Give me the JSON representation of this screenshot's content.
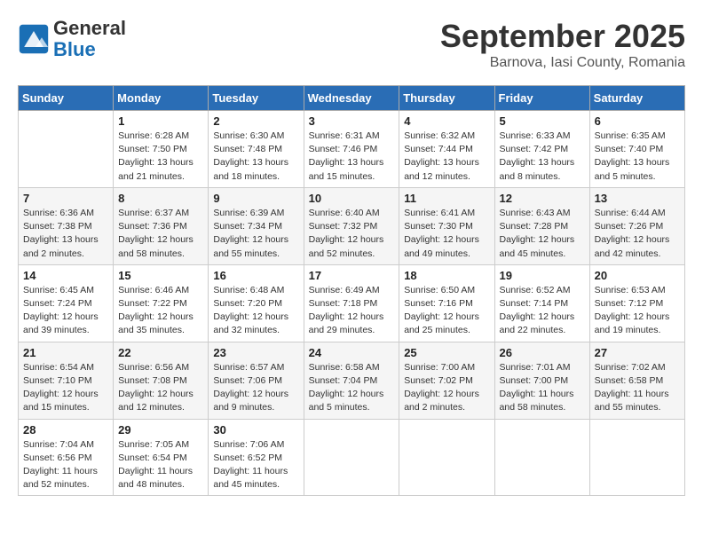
{
  "header": {
    "logo_line1": "General",
    "logo_line2": "Blue",
    "month_title": "September 2025",
    "location": "Barnova, Iasi County, Romania"
  },
  "days_of_week": [
    "Sunday",
    "Monday",
    "Tuesday",
    "Wednesday",
    "Thursday",
    "Friday",
    "Saturday"
  ],
  "weeks": [
    [
      {
        "day": "",
        "info": ""
      },
      {
        "day": "1",
        "info": "Sunrise: 6:28 AM\nSunset: 7:50 PM\nDaylight: 13 hours\nand 21 minutes."
      },
      {
        "day": "2",
        "info": "Sunrise: 6:30 AM\nSunset: 7:48 PM\nDaylight: 13 hours\nand 18 minutes."
      },
      {
        "day": "3",
        "info": "Sunrise: 6:31 AM\nSunset: 7:46 PM\nDaylight: 13 hours\nand 15 minutes."
      },
      {
        "day": "4",
        "info": "Sunrise: 6:32 AM\nSunset: 7:44 PM\nDaylight: 13 hours\nand 12 minutes."
      },
      {
        "day": "5",
        "info": "Sunrise: 6:33 AM\nSunset: 7:42 PM\nDaylight: 13 hours\nand 8 minutes."
      },
      {
        "day": "6",
        "info": "Sunrise: 6:35 AM\nSunset: 7:40 PM\nDaylight: 13 hours\nand 5 minutes."
      }
    ],
    [
      {
        "day": "7",
        "info": "Sunrise: 6:36 AM\nSunset: 7:38 PM\nDaylight: 13 hours\nand 2 minutes."
      },
      {
        "day": "8",
        "info": "Sunrise: 6:37 AM\nSunset: 7:36 PM\nDaylight: 12 hours\nand 58 minutes."
      },
      {
        "day": "9",
        "info": "Sunrise: 6:39 AM\nSunset: 7:34 PM\nDaylight: 12 hours\nand 55 minutes."
      },
      {
        "day": "10",
        "info": "Sunrise: 6:40 AM\nSunset: 7:32 PM\nDaylight: 12 hours\nand 52 minutes."
      },
      {
        "day": "11",
        "info": "Sunrise: 6:41 AM\nSunset: 7:30 PM\nDaylight: 12 hours\nand 49 minutes."
      },
      {
        "day": "12",
        "info": "Sunrise: 6:43 AM\nSunset: 7:28 PM\nDaylight: 12 hours\nand 45 minutes."
      },
      {
        "day": "13",
        "info": "Sunrise: 6:44 AM\nSunset: 7:26 PM\nDaylight: 12 hours\nand 42 minutes."
      }
    ],
    [
      {
        "day": "14",
        "info": "Sunrise: 6:45 AM\nSunset: 7:24 PM\nDaylight: 12 hours\nand 39 minutes."
      },
      {
        "day": "15",
        "info": "Sunrise: 6:46 AM\nSunset: 7:22 PM\nDaylight: 12 hours\nand 35 minutes."
      },
      {
        "day": "16",
        "info": "Sunrise: 6:48 AM\nSunset: 7:20 PM\nDaylight: 12 hours\nand 32 minutes."
      },
      {
        "day": "17",
        "info": "Sunrise: 6:49 AM\nSunset: 7:18 PM\nDaylight: 12 hours\nand 29 minutes."
      },
      {
        "day": "18",
        "info": "Sunrise: 6:50 AM\nSunset: 7:16 PM\nDaylight: 12 hours\nand 25 minutes."
      },
      {
        "day": "19",
        "info": "Sunrise: 6:52 AM\nSunset: 7:14 PM\nDaylight: 12 hours\nand 22 minutes."
      },
      {
        "day": "20",
        "info": "Sunrise: 6:53 AM\nSunset: 7:12 PM\nDaylight: 12 hours\nand 19 minutes."
      }
    ],
    [
      {
        "day": "21",
        "info": "Sunrise: 6:54 AM\nSunset: 7:10 PM\nDaylight: 12 hours\nand 15 minutes."
      },
      {
        "day": "22",
        "info": "Sunrise: 6:56 AM\nSunset: 7:08 PM\nDaylight: 12 hours\nand 12 minutes."
      },
      {
        "day": "23",
        "info": "Sunrise: 6:57 AM\nSunset: 7:06 PM\nDaylight: 12 hours\nand 9 minutes."
      },
      {
        "day": "24",
        "info": "Sunrise: 6:58 AM\nSunset: 7:04 PM\nDaylight: 12 hours\nand 5 minutes."
      },
      {
        "day": "25",
        "info": "Sunrise: 7:00 AM\nSunset: 7:02 PM\nDaylight: 12 hours\nand 2 minutes."
      },
      {
        "day": "26",
        "info": "Sunrise: 7:01 AM\nSunset: 7:00 PM\nDaylight: 11 hours\nand 58 minutes."
      },
      {
        "day": "27",
        "info": "Sunrise: 7:02 AM\nSunset: 6:58 PM\nDaylight: 11 hours\nand 55 minutes."
      }
    ],
    [
      {
        "day": "28",
        "info": "Sunrise: 7:04 AM\nSunset: 6:56 PM\nDaylight: 11 hours\nand 52 minutes."
      },
      {
        "day": "29",
        "info": "Sunrise: 7:05 AM\nSunset: 6:54 PM\nDaylight: 11 hours\nand 48 minutes."
      },
      {
        "day": "30",
        "info": "Sunrise: 7:06 AM\nSunset: 6:52 PM\nDaylight: 11 hours\nand 45 minutes."
      },
      {
        "day": "",
        "info": ""
      },
      {
        "day": "",
        "info": ""
      },
      {
        "day": "",
        "info": ""
      },
      {
        "day": "",
        "info": ""
      }
    ]
  ]
}
